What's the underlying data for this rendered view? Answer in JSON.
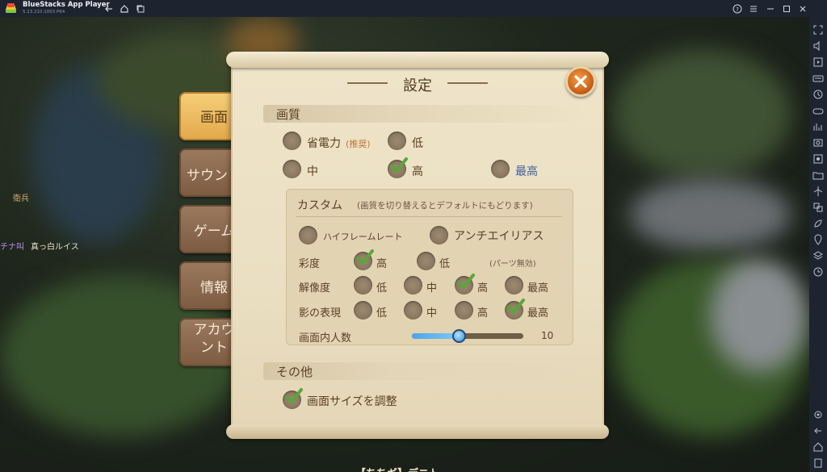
{
  "window": {
    "app_name": "BlueStacks App Player",
    "app_version": "5.13.210.1003 P64"
  },
  "colors": {
    "titlebar_bg": "#1e2330",
    "paper_bg": "#efe4c9",
    "tab_active": "#e3a84b",
    "tab_inactive": "#7d5b41",
    "close_button": "#d2691e",
    "check_green": "#5aa53a",
    "slider_fill": "#4aa6e6"
  },
  "titlebar_icons": [
    "back-icon",
    "home-icon",
    "multi-instance-icon",
    "help-icon",
    "menu-icon",
    "minimize-icon",
    "maximize-icon",
    "close-icon"
  ],
  "sidebar_icons": [
    "fullscreen-icon",
    "volume-icon",
    "media-icon",
    "keyboard-icon",
    "macro-icon",
    "gamepad-icon",
    "performance-icon",
    "screenshot-icon",
    "record-icon",
    "folder-icon",
    "airplane-icon",
    "multi-window-icon",
    "eco-icon",
    "location-icon",
    "layers-icon",
    "sync-icon",
    "settings-icon",
    "back-icon",
    "home-icon",
    "recent-apps-icon"
  ],
  "game_background": {
    "npc_names": [
      "衛兵",
      "チナ叫",
      "真っ白ルイス"
    ],
    "bottom_text": "【ちちギ】デニト"
  },
  "tabs": [
    {
      "label": "画面",
      "active": true
    },
    {
      "label": "サウンド",
      "active": false
    },
    {
      "label": "ゲーム",
      "active": false
    },
    {
      "label": "情報",
      "active": false
    },
    {
      "label": "アカウント",
      "active": false
    }
  ],
  "settings": {
    "title": "設定",
    "quality_section": {
      "header": "画質",
      "options": [
        {
          "label": "省電力",
          "note": "(推奨)",
          "selected": false
        },
        {
          "label": "低",
          "selected": false
        },
        {
          "label": "中",
          "selected": false
        },
        {
          "label": "高",
          "selected": true
        },
        {
          "label": "最高",
          "selected": false
        }
      ]
    },
    "custom": {
      "header": "カスタム",
      "note": "(画質を切り替えるとデフォルトにもどります)",
      "toggles": [
        {
          "label": "ハイフレームレート",
          "checked": false
        },
        {
          "label": "アンチエイリアス",
          "checked": false
        }
      ],
      "saturation": {
        "label": "彩度",
        "options": [
          {
            "label": "高",
            "selected": true
          },
          {
            "label": "低",
            "selected": false
          }
        ],
        "note": "(パーツ無効)"
      },
      "resolution": {
        "label": "解像度",
        "options": [
          {
            "label": "低",
            "selected": false
          },
          {
            "label": "中",
            "selected": false
          },
          {
            "label": "高",
            "selected": true
          },
          {
            "label": "最高",
            "selected": false
          }
        ]
      },
      "shadow": {
        "label": "影の表現",
        "options": [
          {
            "label": "低",
            "selected": false
          },
          {
            "label": "中",
            "selected": false
          },
          {
            "label": "高",
            "selected": false
          },
          {
            "label": "最高",
            "selected": true
          }
        ]
      },
      "people_count": {
        "label": "画面内人数",
        "value": "10",
        "fraction": 0.42
      }
    },
    "other_section": {
      "header": "その他",
      "options": [
        {
          "label": "画面サイズを調整",
          "checked": true
        }
      ]
    }
  }
}
